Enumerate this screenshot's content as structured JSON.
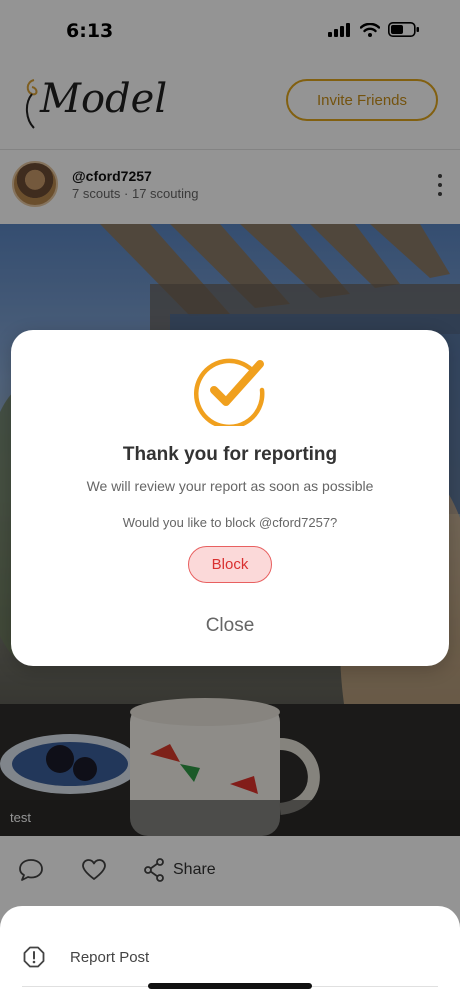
{
  "status": {
    "time": "6:13"
  },
  "header": {
    "logo_text": "Model",
    "invite_label": "Invite Friends"
  },
  "profile": {
    "username": "@cford7257",
    "stats": "7 scouts  ·  17 scouting"
  },
  "post": {
    "caption": "test"
  },
  "actions": {
    "share_label": "Share"
  },
  "modal": {
    "title": "Thank you for reporting",
    "subtitle": "We will review your report as soon as possible",
    "question": "Would you like to block @cford7257?",
    "block_label": "Block",
    "close_label": "Close"
  },
  "sheet": {
    "report_label": "Report Post"
  },
  "colors": {
    "accent": "#e0a51c",
    "check": "#f0a01e",
    "danger": "#d93030",
    "danger_bg": "#fbd9d9"
  },
  "icons": [
    "signal-icon",
    "wifi-icon",
    "battery-icon",
    "comment-icon",
    "heart-icon",
    "share-icon",
    "more-icon",
    "check-icon",
    "alert-icon"
  ]
}
